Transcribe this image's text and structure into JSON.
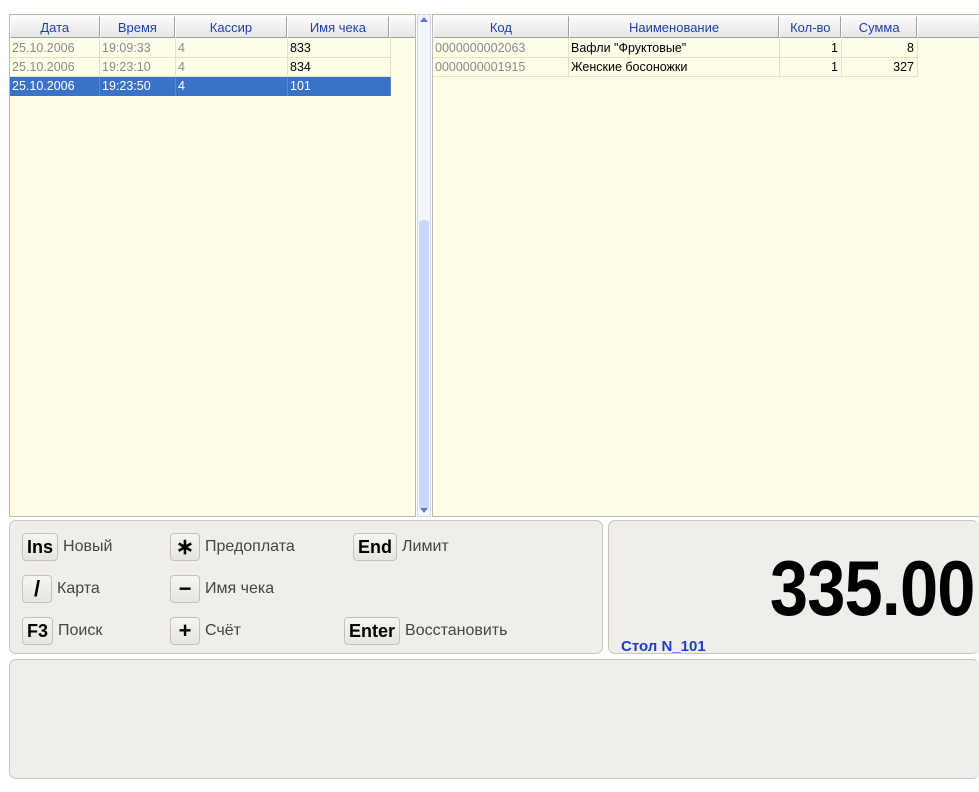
{
  "left_table": {
    "columns": [
      "Дата",
      "Время",
      "Кассир",
      "Имя чека"
    ],
    "rows": [
      {
        "date": "25.10.2006",
        "time": "19:09:33",
        "cashier": "4",
        "receipt": "833"
      },
      {
        "date": "25.10.2006",
        "time": "19:23:10",
        "cashier": "4",
        "receipt": "834"
      },
      {
        "date": "25.10.2006",
        "time": "19:23:50",
        "cashier": "4",
        "receipt": "101"
      }
    ],
    "selected_index": 2
  },
  "right_table": {
    "columns": [
      "Код",
      "Наименование",
      "Кол-во",
      "Сумма"
    ],
    "rows": [
      {
        "code": "0000000002063",
        "name": "Вафли \"Фруктовые\"",
        "qty": "1",
        "sum": "8"
      },
      {
        "code": "0000000001915",
        "name": "Женские босоножки",
        "qty": "1",
        "sum": "327"
      }
    ]
  },
  "keys": [
    {
      "key": "Ins",
      "label": "Новый"
    },
    {
      "key": "∗",
      "label": "Предоплата"
    },
    {
      "key": "End",
      "label": "Лимит"
    },
    {
      "key": "/",
      "label": "Карта"
    },
    {
      "key": "−",
      "label": "Имя чека"
    },
    {
      "key": "F3",
      "label": "Поиск"
    },
    {
      "key": "+",
      "label": "Счёт"
    },
    {
      "key": "Enter",
      "label": "Восстановить"
    }
  ],
  "total": {
    "amount": "335.00",
    "table_label": "Стол N_101"
  },
  "colors": {
    "grid_background": "#fffde8",
    "selection": "#3a72c8",
    "header_text": "#1f3fa8",
    "table_label": "#1a3ec8"
  }
}
